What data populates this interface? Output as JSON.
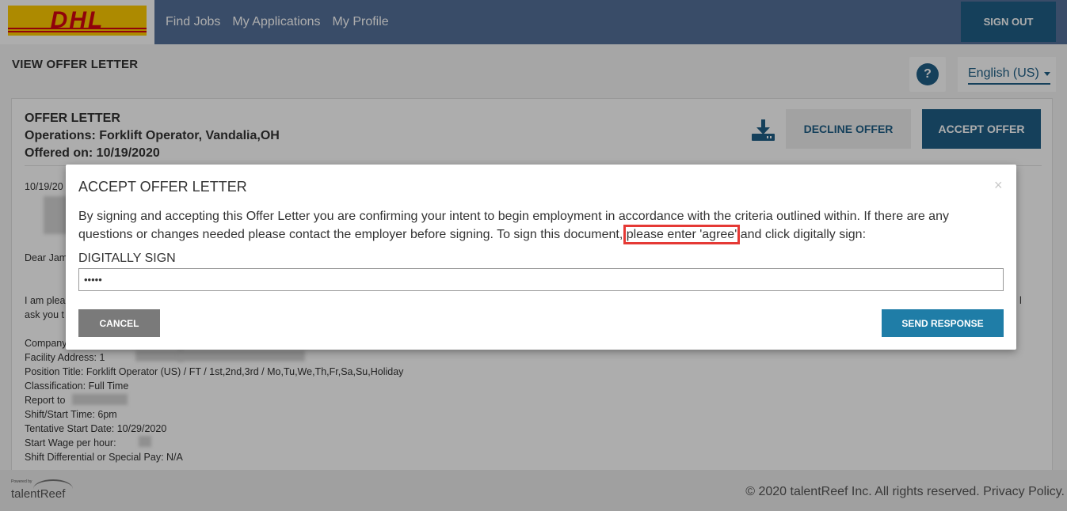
{
  "header": {
    "logo_text": "DHL",
    "nav": [
      "Find Jobs",
      "My Applications",
      "My Profile"
    ],
    "sign_out": "SIGN OUT"
  },
  "page": {
    "title": "VIEW OFFER LETTER",
    "help": "?",
    "language": "English (US)"
  },
  "offer": {
    "heading": "OFFER LETTER",
    "position": "Operations: Forklift Operator, Vandalia,OH",
    "offered_on": "Offered on: 10/19/2020",
    "decline_label": "DECLINE OFFER",
    "accept_label": "ACCEPT OFFER",
    "download_icon": "download-icon"
  },
  "letter": {
    "date": "10/19/20",
    "greeting": "Dear Jam",
    "intro_1": "I am plea",
    "intro_1_end": "l",
    "intro_2": "ask you t",
    "company": "Company",
    "facility": "Facility Address: 1",
    "position_title": "Position Title: Forklift Operator (US) / FT / 1st,2nd,3rd / Mo,Tu,We,Th,Fr,Sa,Su,Holiday",
    "classification": "Classification: Full Time",
    "report_to": "Report to",
    "shift": "Shift/Start Time: 6pm",
    "start_date": "Tentative Start Date: 10/29/2020",
    "wage": "Start Wage per hour:",
    "differential": "Shift Differential or Special Pay: N/A"
  },
  "modal": {
    "title": "ACCEPT OFFER LETTER",
    "close": "×",
    "body_before": "By signing and accepting this Offer Letter you are confirming your intent to begin employment in accordance with the criteria outlined within. If there are any questions or changes needed please contact the employer before signing. To sign this document,",
    "body_highlight": "please enter 'agree'",
    "body_after": "and click digitally sign:",
    "sign_label": "DIGITALLY SIGN",
    "sign_value": "•••••",
    "cancel_label": "CANCEL",
    "send_label": "SEND RESPONSE"
  },
  "footer": {
    "powered_by": "Powered by",
    "brand": "talentReef",
    "copyright": "© 2020 talentReef Inc. All rights reserved. Privacy Policy."
  },
  "colors": {
    "header_bg": "#54709a",
    "primary": "#1f5f86",
    "dhl_yellow": "#ffcc00",
    "dhl_red": "#d40511",
    "highlight_box": "#e53935"
  }
}
